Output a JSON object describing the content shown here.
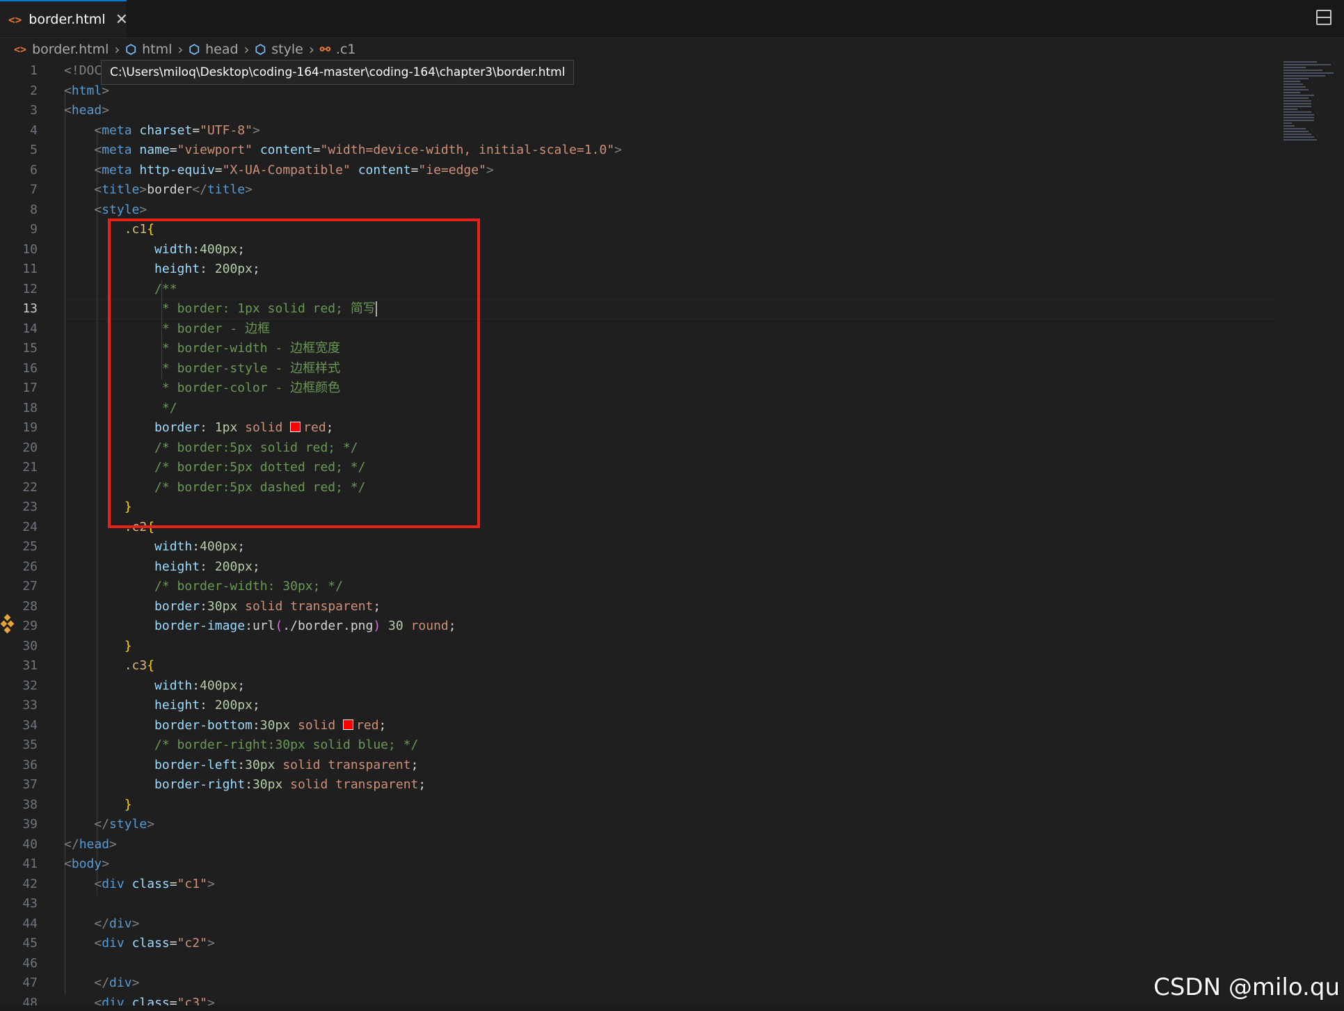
{
  "tab": {
    "file_icon": "<>",
    "name": "border.html",
    "close": "✕"
  },
  "breadcrumb": {
    "file": "border.html",
    "items": [
      "html",
      "head",
      "style",
      ".c1"
    ]
  },
  "tooltip": "C:\\Users\\miloq\\Desktop\\coding-164-master\\coding-164\\chapter3\\border.html",
  "editor": {
    "active_line": 13,
    "line_numbers": [
      "1",
      "2",
      "3",
      "4",
      "5",
      "6",
      "7",
      "8",
      "9",
      "10",
      "11",
      "12",
      "13",
      "14",
      "15",
      "16",
      "17",
      "18",
      "19",
      "20",
      "21",
      "22",
      "23",
      "24",
      "25",
      "26",
      "27",
      "28",
      "29",
      "30",
      "31",
      "32",
      "33",
      "34",
      "35",
      "36",
      "37",
      "38",
      "39",
      "40",
      "41",
      "42",
      "43",
      "44",
      "45",
      "46",
      "47",
      "48"
    ],
    "lines": [
      [
        [
          "bracket",
          "<!DOC"
        ]
      ],
      [
        [
          "bracket",
          "<"
        ],
        [
          "tag",
          "html"
        ],
        [
          "bracket",
          ">"
        ]
      ],
      [
        [
          "bracket",
          "<"
        ],
        [
          "tag",
          "head"
        ],
        [
          "bracket",
          ">"
        ]
      ],
      [
        [
          "plain",
          "    "
        ],
        [
          "bracket",
          "<"
        ],
        [
          "tag",
          "meta"
        ],
        [
          "plain",
          " "
        ],
        [
          "attr",
          "charset"
        ],
        [
          "plain",
          "="
        ],
        [
          "str",
          "\"UTF-8\""
        ],
        [
          "bracket",
          ">"
        ]
      ],
      [
        [
          "plain",
          "    "
        ],
        [
          "bracket",
          "<"
        ],
        [
          "tag",
          "meta"
        ],
        [
          "plain",
          " "
        ],
        [
          "attr",
          "name"
        ],
        [
          "plain",
          "="
        ],
        [
          "str",
          "\"viewport\""
        ],
        [
          "plain",
          " "
        ],
        [
          "attr",
          "content"
        ],
        [
          "plain",
          "="
        ],
        [
          "str",
          "\"width=device-width, initial-scale=1.0\""
        ],
        [
          "bracket",
          ">"
        ]
      ],
      [
        [
          "plain",
          "    "
        ],
        [
          "bracket",
          "<"
        ],
        [
          "tag",
          "meta"
        ],
        [
          "plain",
          " "
        ],
        [
          "attr",
          "http-equiv"
        ],
        [
          "plain",
          "="
        ],
        [
          "str",
          "\"X-UA-Compatible\""
        ],
        [
          "plain",
          " "
        ],
        [
          "attr",
          "content"
        ],
        [
          "plain",
          "="
        ],
        [
          "str",
          "\"ie=edge\""
        ],
        [
          "bracket",
          ">"
        ]
      ],
      [
        [
          "plain",
          "    "
        ],
        [
          "bracket",
          "<"
        ],
        [
          "tag",
          "title"
        ],
        [
          "bracket",
          ">"
        ],
        [
          "plain",
          "border"
        ],
        [
          "bracket",
          "</"
        ],
        [
          "tag",
          "title"
        ],
        [
          "bracket",
          ">"
        ]
      ],
      [
        [
          "plain",
          "    "
        ],
        [
          "bracket",
          "<"
        ],
        [
          "tag",
          "style"
        ],
        [
          "bracket",
          ">"
        ]
      ],
      [
        [
          "plain",
          "        "
        ],
        [
          "sel",
          ".c1"
        ],
        [
          "brace",
          "{"
        ]
      ],
      [
        [
          "plain",
          "            "
        ],
        [
          "prop",
          "width"
        ],
        [
          "plain",
          ":"
        ],
        [
          "num",
          "400px"
        ],
        [
          "plain",
          ";"
        ]
      ],
      [
        [
          "plain",
          "            "
        ],
        [
          "prop",
          "height"
        ],
        [
          "plain",
          ": "
        ],
        [
          "num",
          "200px"
        ],
        [
          "plain",
          ";"
        ]
      ],
      [
        [
          "plain",
          "            "
        ],
        [
          "comment",
          "/**"
        ]
      ],
      [
        [
          "plain",
          "             "
        ],
        [
          "comment",
          "* border: 1px solid red; 简写"
        ],
        [
          "cursor",
          ""
        ]
      ],
      [
        [
          "plain",
          "             "
        ],
        [
          "comment",
          "* border - 边框"
        ]
      ],
      [
        [
          "plain",
          "             "
        ],
        [
          "comment",
          "* border-width - 边框宽度"
        ]
      ],
      [
        [
          "plain",
          "             "
        ],
        [
          "comment",
          "* border-style - 边框样式"
        ]
      ],
      [
        [
          "plain",
          "             "
        ],
        [
          "comment",
          "* border-color - 边框颜色"
        ]
      ],
      [
        [
          "plain",
          "             "
        ],
        [
          "comment",
          "*/"
        ]
      ],
      [
        [
          "plain",
          "            "
        ],
        [
          "prop",
          "border"
        ],
        [
          "plain",
          ": "
        ],
        [
          "num",
          "1px"
        ],
        [
          "plain",
          " "
        ],
        [
          "val",
          "solid"
        ],
        [
          "plain",
          " "
        ],
        [
          "swatch",
          ""
        ],
        [
          "val",
          "red"
        ],
        [
          "plain",
          ";"
        ]
      ],
      [
        [
          "plain",
          "            "
        ],
        [
          "comment",
          "/* border:5px solid red; */"
        ]
      ],
      [
        [
          "plain",
          "            "
        ],
        [
          "comment",
          "/* border:5px dotted red; */"
        ]
      ],
      [
        [
          "plain",
          "            "
        ],
        [
          "comment",
          "/* border:5px dashed red; */"
        ]
      ],
      [
        [
          "plain",
          "        "
        ],
        [
          "brace",
          "}"
        ]
      ],
      [
        [
          "plain",
          "        "
        ],
        [
          "sel",
          ".c2"
        ],
        [
          "brace",
          "{"
        ]
      ],
      [
        [
          "plain",
          "            "
        ],
        [
          "prop",
          "width"
        ],
        [
          "plain",
          ":"
        ],
        [
          "num",
          "400px"
        ],
        [
          "plain",
          ";"
        ]
      ],
      [
        [
          "plain",
          "            "
        ],
        [
          "prop",
          "height"
        ],
        [
          "plain",
          ": "
        ],
        [
          "num",
          "200px"
        ],
        [
          "plain",
          ";"
        ]
      ],
      [
        [
          "plain",
          "            "
        ],
        [
          "comment",
          "/* border-width: 30px; */"
        ]
      ],
      [
        [
          "plain",
          "            "
        ],
        [
          "prop",
          "border"
        ],
        [
          "plain",
          ":"
        ],
        [
          "num",
          "30px"
        ],
        [
          "plain",
          " "
        ],
        [
          "val",
          "solid"
        ],
        [
          "plain",
          " "
        ],
        [
          "val",
          "transparent"
        ],
        [
          "plain",
          ";"
        ]
      ],
      [
        [
          "plain",
          "            "
        ],
        [
          "prop",
          "border-image"
        ],
        [
          "plain",
          ":"
        ],
        [
          "plain",
          "url"
        ],
        [
          "paren",
          "("
        ],
        [
          "plain",
          "./border.png"
        ],
        [
          "paren",
          ")"
        ],
        [
          "plain",
          " "
        ],
        [
          "num",
          "30"
        ],
        [
          "plain",
          " "
        ],
        [
          "val",
          "round"
        ],
        [
          "plain",
          ";"
        ]
      ],
      [
        [
          "plain",
          "        "
        ],
        [
          "brace",
          "}"
        ]
      ],
      [
        [
          "plain",
          "        "
        ],
        [
          "sel",
          ".c3"
        ],
        [
          "brace",
          "{"
        ]
      ],
      [
        [
          "plain",
          "            "
        ],
        [
          "prop",
          "width"
        ],
        [
          "plain",
          ":"
        ],
        [
          "num",
          "400px"
        ],
        [
          "plain",
          ";"
        ]
      ],
      [
        [
          "plain",
          "            "
        ],
        [
          "prop",
          "height"
        ],
        [
          "plain",
          ": "
        ],
        [
          "num",
          "200px"
        ],
        [
          "plain",
          ";"
        ]
      ],
      [
        [
          "plain",
          "            "
        ],
        [
          "prop",
          "border-bottom"
        ],
        [
          "plain",
          ":"
        ],
        [
          "num",
          "30px"
        ],
        [
          "plain",
          " "
        ],
        [
          "val",
          "solid"
        ],
        [
          "plain",
          " "
        ],
        [
          "swatch",
          ""
        ],
        [
          "val",
          "red"
        ],
        [
          "plain",
          ";"
        ]
      ],
      [
        [
          "plain",
          "            "
        ],
        [
          "comment",
          "/* border-right:30px solid blue; */"
        ]
      ],
      [
        [
          "plain",
          "            "
        ],
        [
          "prop",
          "border-left"
        ],
        [
          "plain",
          ":"
        ],
        [
          "num",
          "30px"
        ],
        [
          "plain",
          " "
        ],
        [
          "val",
          "solid"
        ],
        [
          "plain",
          " "
        ],
        [
          "val",
          "transparent"
        ],
        [
          "plain",
          ";"
        ]
      ],
      [
        [
          "plain",
          "            "
        ],
        [
          "prop",
          "border-right"
        ],
        [
          "plain",
          ":"
        ],
        [
          "num",
          "30px"
        ],
        [
          "plain",
          " "
        ],
        [
          "val",
          "solid"
        ],
        [
          "plain",
          " "
        ],
        [
          "val",
          "transparent"
        ],
        [
          "plain",
          ";"
        ]
      ],
      [
        [
          "plain",
          "        "
        ],
        [
          "brace",
          "}"
        ]
      ],
      [
        [
          "plain",
          "    "
        ],
        [
          "bracket",
          "</"
        ],
        [
          "tag",
          "style"
        ],
        [
          "bracket",
          ">"
        ]
      ],
      [
        [
          "bracket",
          "</"
        ],
        [
          "tag",
          "head"
        ],
        [
          "bracket",
          ">"
        ]
      ],
      [
        [
          "bracket",
          "<"
        ],
        [
          "tag",
          "body"
        ],
        [
          "bracket",
          ">"
        ]
      ],
      [
        [
          "plain",
          "    "
        ],
        [
          "bracket",
          "<"
        ],
        [
          "tag",
          "div"
        ],
        [
          "plain",
          " "
        ],
        [
          "attr",
          "class"
        ],
        [
          "plain",
          "="
        ],
        [
          "str",
          "\"c1\""
        ],
        [
          "bracket",
          ">"
        ]
      ],
      [
        [
          "plain",
          ""
        ]
      ],
      [
        [
          "plain",
          "    "
        ],
        [
          "bracket",
          "</"
        ],
        [
          "tag",
          "div"
        ],
        [
          "bracket",
          ">"
        ]
      ],
      [
        [
          "plain",
          "    "
        ],
        [
          "bracket",
          "<"
        ],
        [
          "tag",
          "div"
        ],
        [
          "plain",
          " "
        ],
        [
          "attr",
          "class"
        ],
        [
          "plain",
          "="
        ],
        [
          "str",
          "\"c2\""
        ],
        [
          "bracket",
          ">"
        ]
      ],
      [
        [
          "plain",
          ""
        ]
      ],
      [
        [
          "plain",
          "    "
        ],
        [
          "bracket",
          "</"
        ],
        [
          "tag",
          "div"
        ],
        [
          "bracket",
          ">"
        ]
      ],
      [
        [
          "plain",
          "    "
        ],
        [
          "bracket",
          "<"
        ],
        [
          "tag",
          "div"
        ],
        [
          "plain",
          " "
        ],
        [
          "attr",
          "class"
        ],
        [
          "plain",
          "="
        ],
        [
          "str",
          "\"c3\""
        ],
        [
          "bracket",
          ">"
        ]
      ]
    ]
  },
  "watermark": "CSDN @milo.qu",
  "colors": {
    "accent": "#0078d4",
    "highlight_box": "#e8211b",
    "background": "#1f1f1f"
  },
  "icons": {
    "file": "html-file-icon",
    "element": "cube-icon",
    "selector": "symbol-class-icon",
    "layout": "split-editor-icon"
  }
}
